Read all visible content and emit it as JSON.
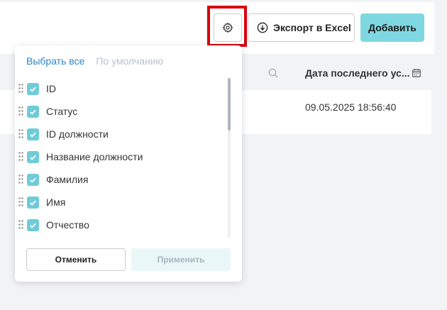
{
  "toolbar": {
    "settings_icon": "gear-icon",
    "export_icon": "download-circle-icon",
    "export_label": "Экспорт в Excel",
    "add_label": "Добавить"
  },
  "table": {
    "column_title": "Дата последнего ус...",
    "search_icon": "search-icon",
    "calendar_icon": "calendar-icon",
    "rows": [
      {
        "date": "09.05.2025 18:56:40"
      }
    ]
  },
  "column_settings": {
    "select_all_label": "Выбрать все",
    "default_label": "По умолчанию",
    "columns": [
      {
        "label": "ID",
        "checked": true
      },
      {
        "label": "Статус",
        "checked": true
      },
      {
        "label": "ID должности",
        "checked": true
      },
      {
        "label": "Название должности",
        "checked": true
      },
      {
        "label": "Фамилия",
        "checked": true
      },
      {
        "label": "Имя",
        "checked": true
      },
      {
        "label": "Отчество",
        "checked": true
      }
    ],
    "cancel_label": "Отменить",
    "apply_label": "Применить"
  },
  "colors": {
    "accent": "#7fd8e1",
    "checkbox": "#6fcbd8",
    "link": "#2d85c8",
    "highlight": "#d9000d"
  }
}
